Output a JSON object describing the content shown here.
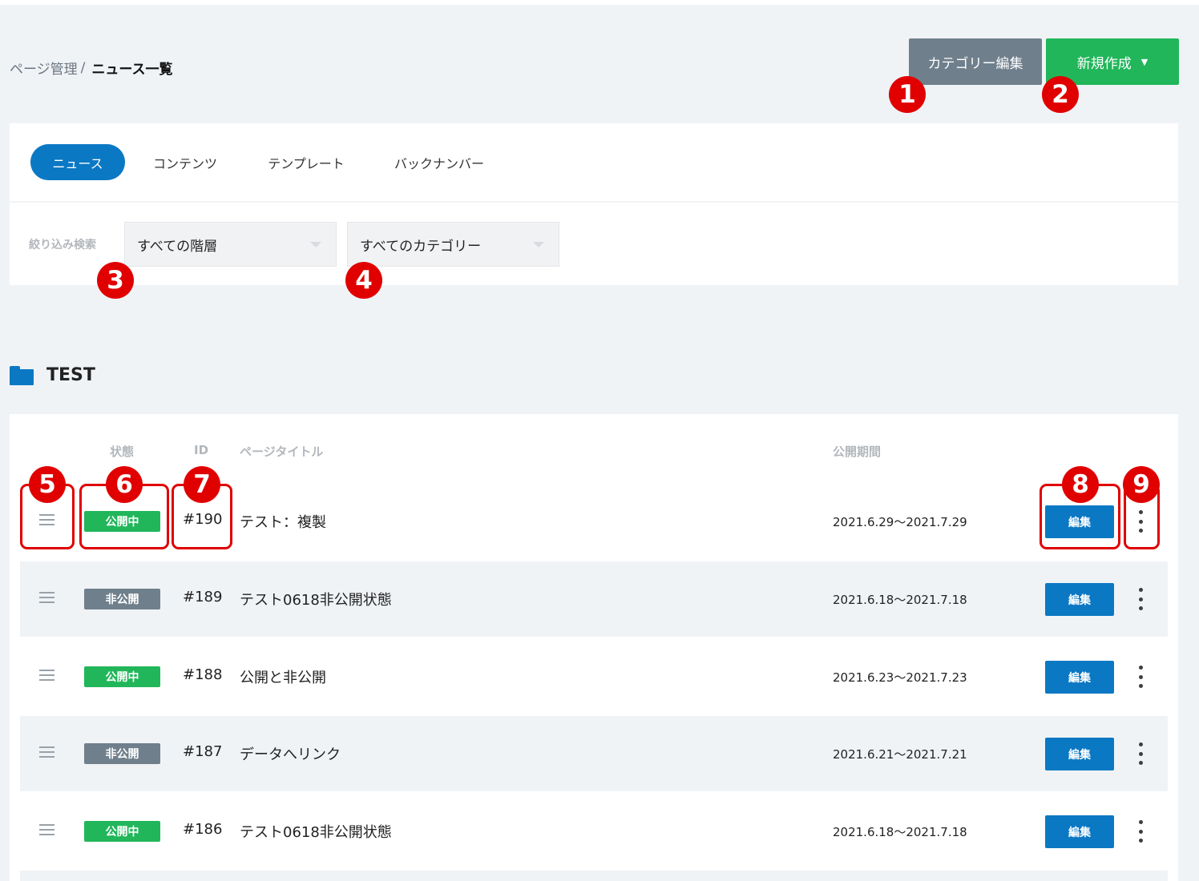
{
  "header": {
    "breadcrumb_parent": "ページ管理",
    "breadcrumb_sep": "/",
    "breadcrumb_current": "ニュース一覧",
    "category_edit_label": "カテゴリー編集",
    "new_create_label": "新規作成"
  },
  "tabs": [
    {
      "label": "ニュース",
      "active": true
    },
    {
      "label": "コンテンツ"
    },
    {
      "label": "テンプレート"
    },
    {
      "label": "バックナンバー"
    }
  ],
  "filter": {
    "label": "絞り込み検索",
    "hierarchy_value": "すべての階層",
    "category_value": "すべてのカテゴリー"
  },
  "folder": {
    "name": "TEST"
  },
  "table": {
    "columns": {
      "status": "状態",
      "id": "ID",
      "title": "ページタイトル",
      "period": "公開期間"
    },
    "rows": [
      {
        "status": "公開中",
        "status_type": "published",
        "id": "#190",
        "title": "テスト：複製",
        "period": "2021.6.29〜2021.7.29",
        "edit": "編集"
      },
      {
        "status": "非公開",
        "status_type": "private",
        "id": "#189",
        "title": "テスト0618非公開状態",
        "period": "2021.6.18〜2021.7.18",
        "edit": "編集"
      },
      {
        "status": "公開中",
        "status_type": "published",
        "id": "#188",
        "title": "公開と非公開",
        "period": "2021.6.23〜2021.7.23",
        "edit": "編集"
      },
      {
        "status": "非公開",
        "status_type": "private",
        "id": "#187",
        "title": "データへリンク",
        "period": "2021.6.21〜2021.7.21",
        "edit": "編集"
      },
      {
        "status": "公開中",
        "status_type": "published",
        "id": "#186",
        "title": "テスト0618非公開状態",
        "period": "2021.6.18〜2021.7.18",
        "edit": "編集"
      }
    ]
  },
  "annotations": [
    "1",
    "2",
    "3",
    "4",
    "5",
    "6",
    "7",
    "8",
    "9"
  ],
  "colors": {
    "primary_blue": "#0b78c4",
    "green": "#21b65a",
    "gray": "#6f7f8c",
    "marker_red": "#e00000",
    "background": "#f0f3f6"
  },
  "icons": [
    "folder-icon",
    "drag-handle-icon",
    "more-vertical-icon",
    "caret-down-icon"
  ]
}
